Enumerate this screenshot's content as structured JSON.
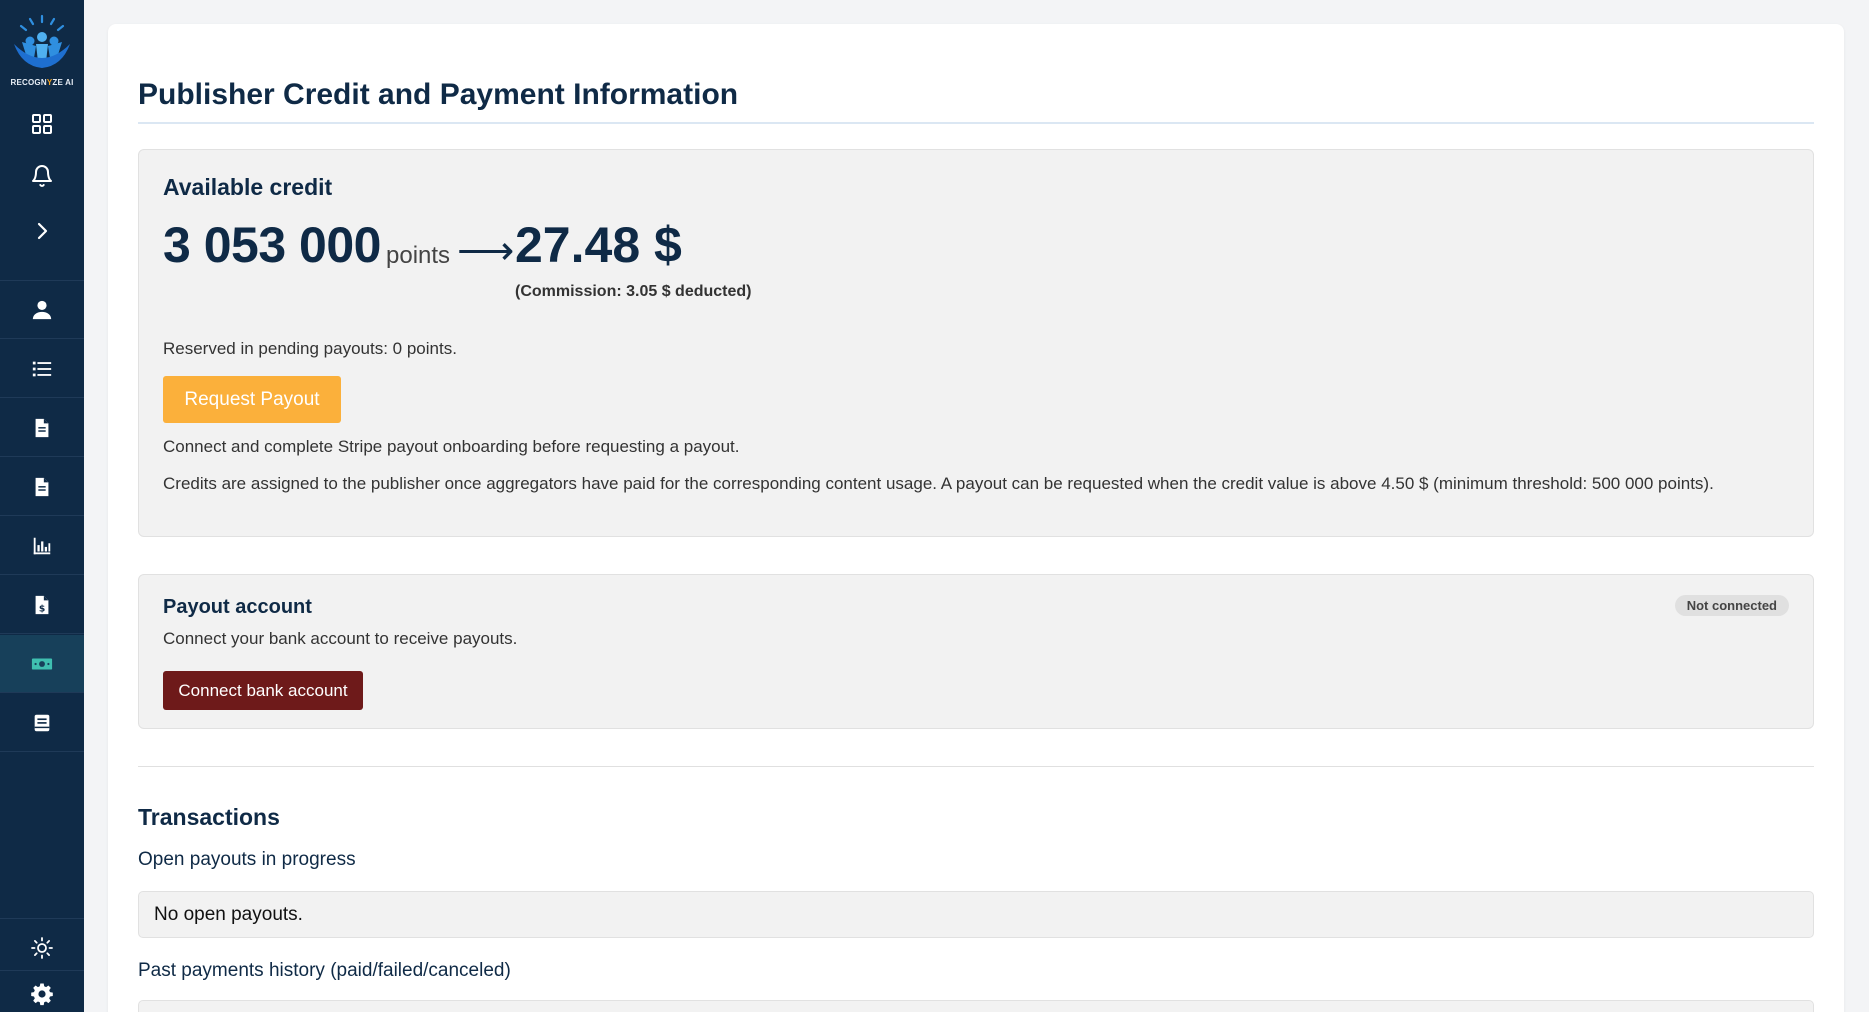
{
  "brand": {
    "logo_text_part1": "RECOGN",
    "logo_text_highlight": "Y",
    "logo_text_part2": "ZE AI",
    "accent_color": "#f6a623",
    "sidebar_color": "#0f2a46"
  },
  "sidebar": {
    "top_icons": [
      "dashboard-icon",
      "bell-icon",
      "chevron-right-icon"
    ],
    "items": [
      {
        "icon": "user-icon",
        "active": false
      },
      {
        "icon": "list-icon",
        "active": false
      },
      {
        "icon": "document-icon",
        "active": false
      },
      {
        "icon": "document-icon",
        "active": false
      },
      {
        "icon": "bar-chart-icon",
        "active": false
      },
      {
        "icon": "invoice-dollar-icon",
        "active": false
      },
      {
        "icon": "money-bill-icon",
        "active": true
      },
      {
        "icon": "book-icon",
        "active": false
      }
    ],
    "bottom_icons": [
      "sun-icon",
      "gear-icon"
    ]
  },
  "page": {
    "title": "Publisher Credit and Payment Information"
  },
  "credit": {
    "heading": "Available credit",
    "points_value": "3 053 000",
    "points_unit": "points",
    "arrow": "⟶",
    "usd_value": "27.48 $",
    "commission": "(Commission: 3.05 $ deducted)",
    "reserved": "Reserved in pending payouts: 0 points.",
    "request_button": "Request Payout",
    "connect_note": "Connect and complete Stripe payout onboarding before requesting a payout.",
    "credits_note": "Credits are assigned to the publisher once aggregators have paid for the corresponding content usage. A payout can be requested when the credit value is above 4.50 $ (minimum threshold: 500 000 points).",
    "request_button_color": "#fbb03b"
  },
  "payout_account": {
    "heading": "Payout account",
    "status_badge": "Not connected",
    "description": "Connect your bank account to receive payouts.",
    "connect_button": "Connect bank account",
    "connect_button_color": "#6e1a1a"
  },
  "transactions": {
    "heading": "Transactions",
    "open_heading": "Open payouts in progress",
    "open_empty": "No open payouts.",
    "past_heading": "Past payments history (paid/failed/canceled)"
  }
}
